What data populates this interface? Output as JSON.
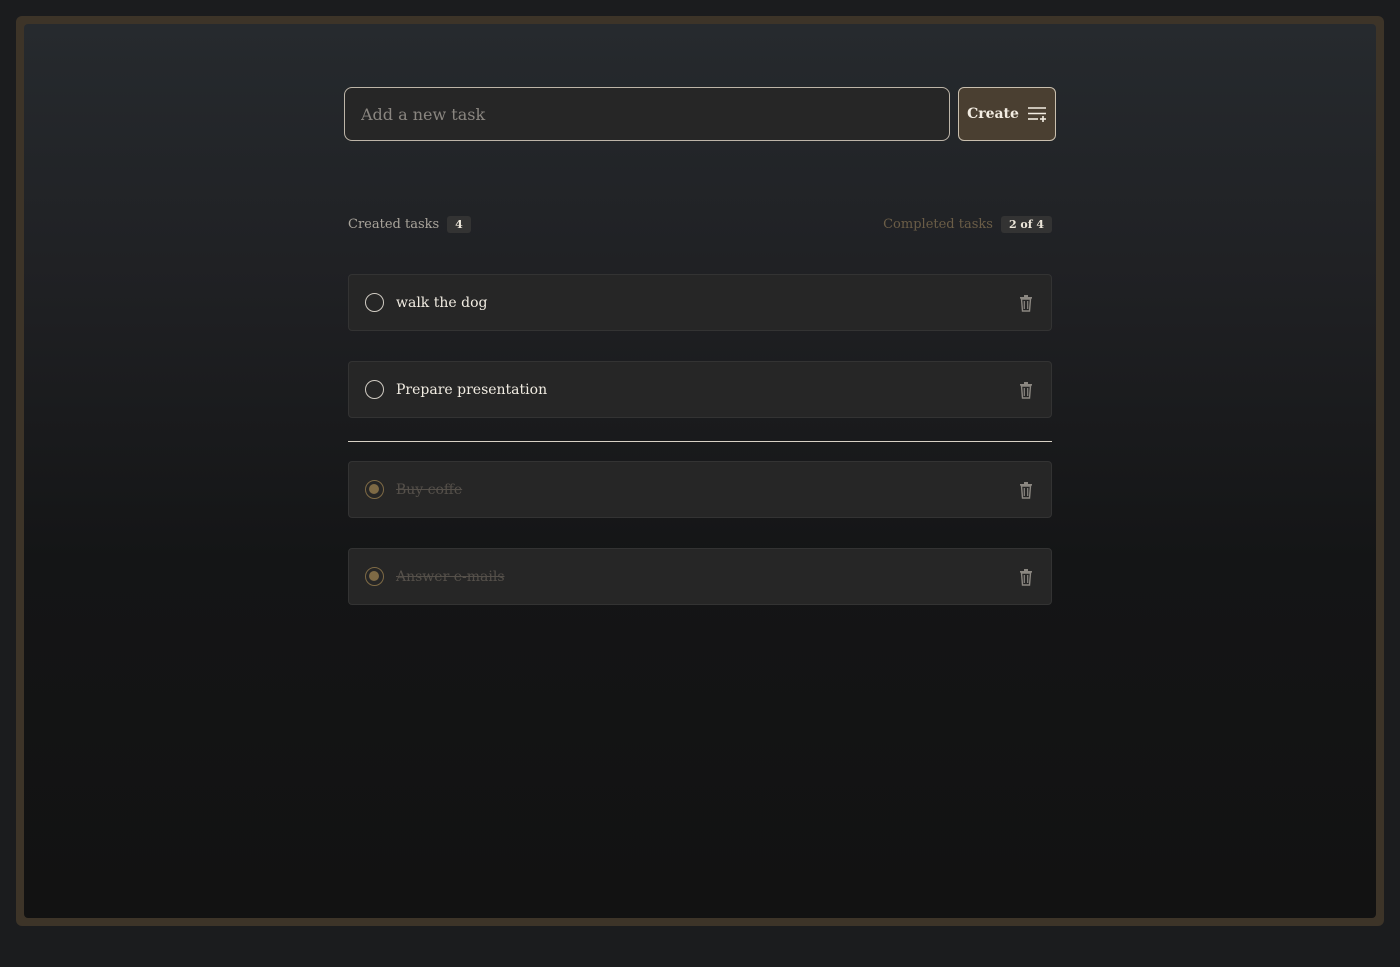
{
  "input": {
    "placeholder": "Add a new task"
  },
  "create_button": {
    "label": "Create"
  },
  "stats": {
    "created_label": "Created tasks",
    "created_count": "4",
    "completed_label": "Completed tasks",
    "completed_count": "2 of 4"
  },
  "tasks": [
    {
      "text": "walk the dog",
      "done": false
    },
    {
      "text": "Prepare presentation",
      "done": false
    },
    {
      "text": "Buy coffe",
      "done": true
    },
    {
      "text": "Answer e-mails",
      "done": true
    }
  ],
  "colors": {
    "accent": "#7e6a45",
    "button_bg": "#4a3f31",
    "frame": "#3d3428"
  },
  "icons": {
    "create": "list-add-icon",
    "delete": "trash-icon",
    "todo": "circle-icon",
    "done": "checked-circle-icon"
  }
}
